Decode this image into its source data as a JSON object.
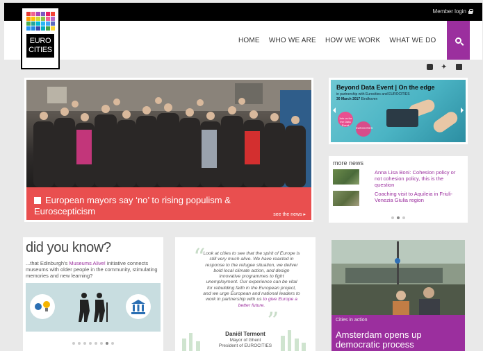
{
  "header": {
    "member_login": "Member login"
  },
  "logo": {
    "line1": "EURO",
    "line2": "CITIES"
  },
  "nav": {
    "items": [
      "HOME",
      "WHO WE ARE",
      "HOW WE WORK",
      "WHAT WE DO"
    ]
  },
  "hero": {
    "title": "European mayors say ‘no’ to rising populism & Euroscepticism",
    "see_news": "see the news ▸"
  },
  "event": {
    "title": "Beyond Data Event | On the edge",
    "subtitle": "in partnership with Eurocities and EUROCITIES",
    "date": "30 March 2017",
    "hosted": "Eindhoven",
    "badge1": "Join us for the Data Event",
    "badge2": "EUROCITIES"
  },
  "more_news": {
    "heading": "more news",
    "items": [
      "Anna Lisa Boni: Cohesion policy or not cohesion policy, this is the question",
      "Coaching visit to Aquileia in Friuli-Venezia Giulia region"
    ]
  },
  "did_you_know": {
    "heading": "did you know?",
    "text_pre": "...that Edinburgh's ",
    "text_link": "Museums Alive!",
    "text_post": " initiative connects museums with older people in the community, stimulating memories and new learning?"
  },
  "quote": {
    "text_pre": "Look at cities to see that the spirit of Europe is still very much alive. We have reacted in response to the refugee situation, we deliver bold local climate action, and design innovative programmes to fight unemployment. Our experience can be vital for rebuilding faith in the European project, and we urge European and national leaders to work in partnership with us ",
    "text_link": "to give Europe a better future.",
    "name": "Daniël Termont",
    "role1": "Mayor of Ghent",
    "role2": "President of EUROCITIES"
  },
  "amsterdam": {
    "category": "Cities in action",
    "title": "Amsterdam opens up democratic process"
  },
  "colors": {
    "accent": "#9b2f9e",
    "hero_red": "#e94f4f",
    "event_teal": "#4bb4c4"
  },
  "icons": {
    "search": "search-icon",
    "lock": "lock-icon",
    "social": [
      "flickr-icon",
      "twitter-icon",
      "youtube-icon"
    ]
  }
}
